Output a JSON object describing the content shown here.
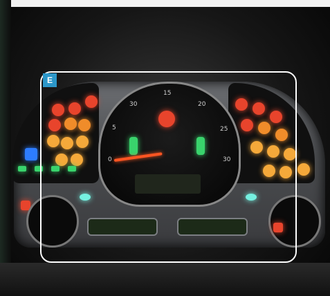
{
  "image_label": "E",
  "scale": {
    "ticks": [
      "30",
      "15",
      "20",
      "5",
      "25",
      "0",
      "30"
    ]
  }
}
